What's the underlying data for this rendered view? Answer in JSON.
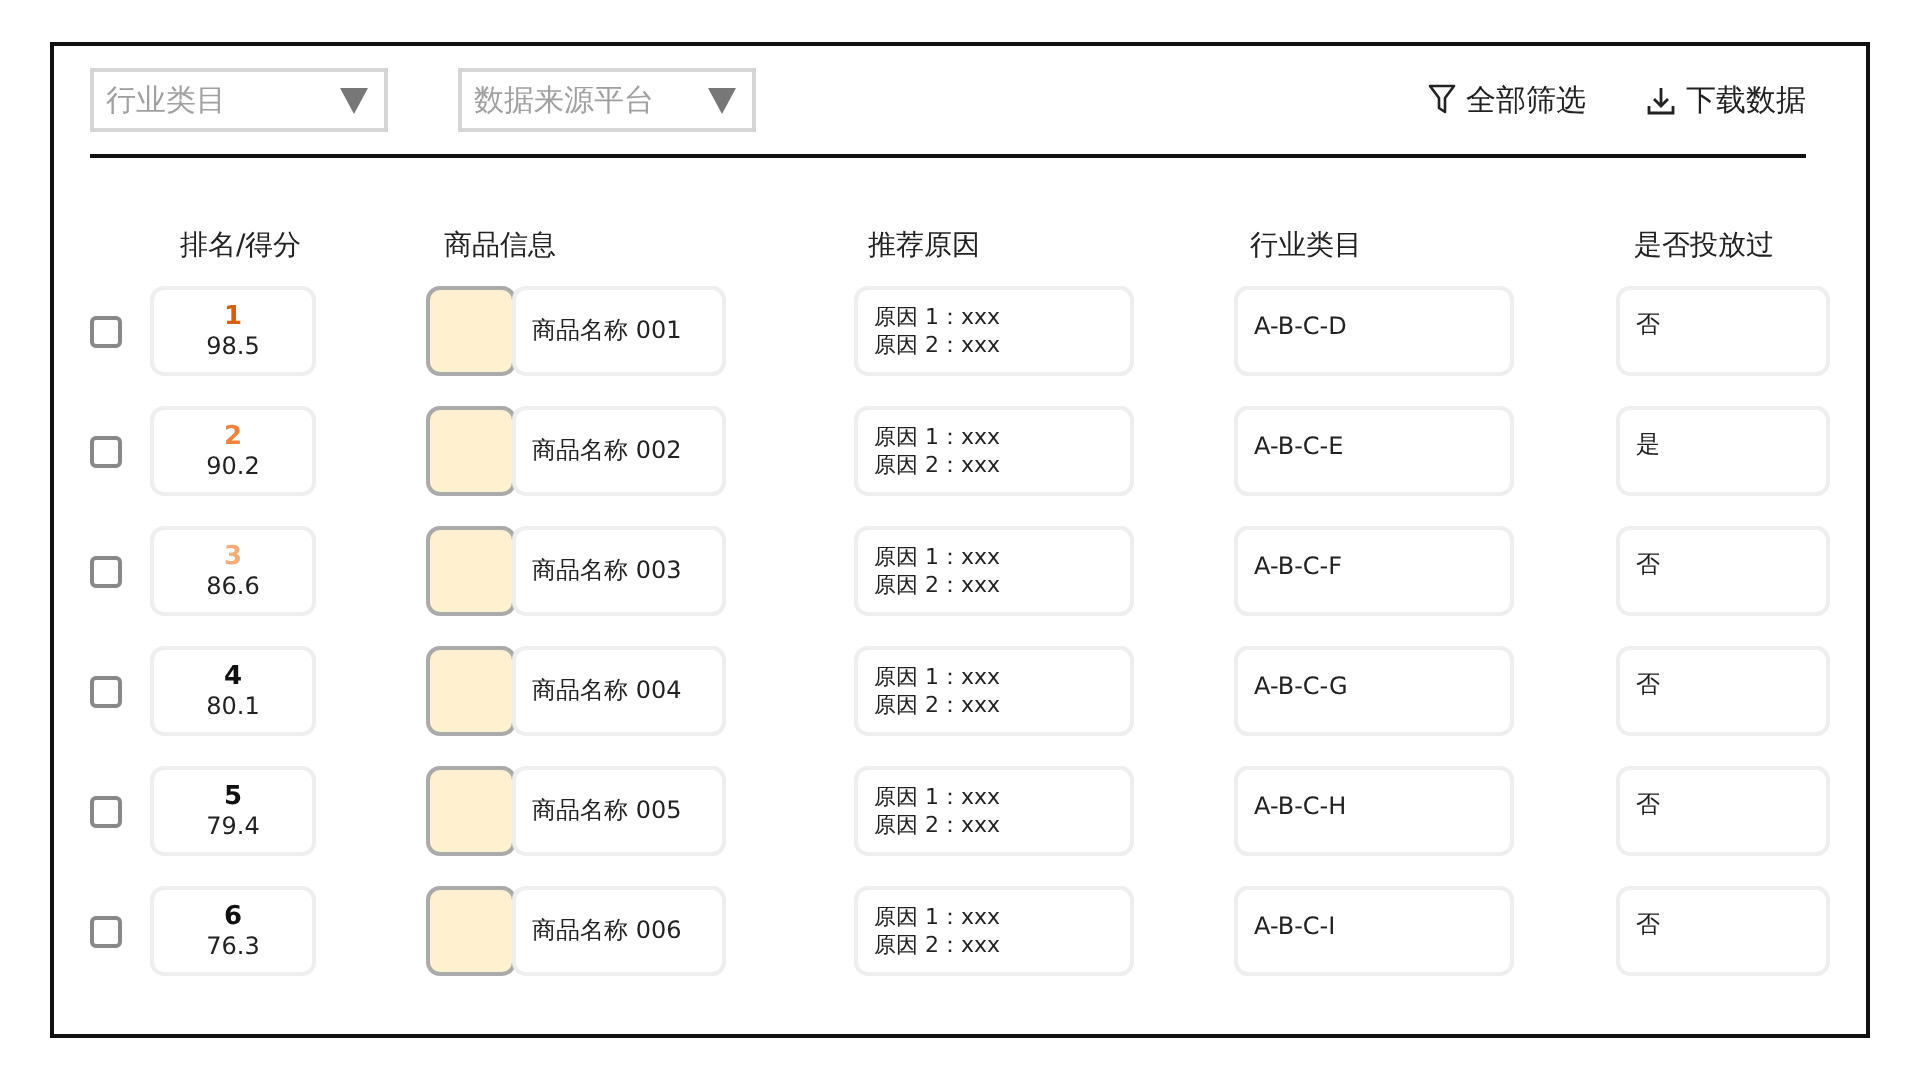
{
  "filters": [
    {
      "placeholder": "行业类目"
    },
    {
      "placeholder": "数据来源平台"
    }
  ],
  "actions": [
    {
      "kind": "filter",
      "label": "全部筛选"
    },
    {
      "kind": "download",
      "label": "下载数据"
    }
  ],
  "columns": [
    "排名/得分",
    "商品信息",
    "推荐原因",
    "行业类目",
    "是否投放过"
  ],
  "rows": [
    {
      "checked": false,
      "rank": "1",
      "color": "#d9600a",
      "score": "98.5",
      "name": "商品名称 001",
      "reasons": [
        "原因 1：xxx",
        "原因 2：xxx"
      ],
      "category": "A-B-C-D",
      "placed": "否"
    },
    {
      "checked": false,
      "rank": "2",
      "color": "#f0823a",
      "score": "90.2",
      "name": "商品名称 002",
      "reasons": [
        "原因 1：xxx",
        "原因 2：xxx"
      ],
      "category": "A-B-C-E",
      "placed": "是"
    },
    {
      "checked": false,
      "rank": "3",
      "color": "#f4ad78",
      "score": "86.6",
      "name": "商品名称 003",
      "reasons": [
        "原因 1：xxx",
        "原因 2：xxx"
      ],
      "category": "A-B-C-F",
      "placed": "否"
    },
    {
      "checked": false,
      "rank": "4",
      "color": "#111111",
      "score": "80.1",
      "name": "商品名称 004",
      "reasons": [
        "原因 1：xxx",
        "原因 2：xxx"
      ],
      "category": "A-B-C-G",
      "placed": "否"
    },
    {
      "checked": false,
      "rank": "5",
      "color": "#111111",
      "score": "79.4",
      "name": "商品名称 005",
      "reasons": [
        "原因 1：xxx",
        "原因 2：xxx"
      ],
      "category": "A-B-C-H",
      "placed": "否"
    },
    {
      "checked": false,
      "rank": "6",
      "color": "#111111",
      "score": "76.3",
      "name": "商品名称 006",
      "reasons": [
        "原因 1：xxx",
        "原因 2：xxx"
      ],
      "category": "A-B-C-I",
      "placed": "否"
    }
  ]
}
